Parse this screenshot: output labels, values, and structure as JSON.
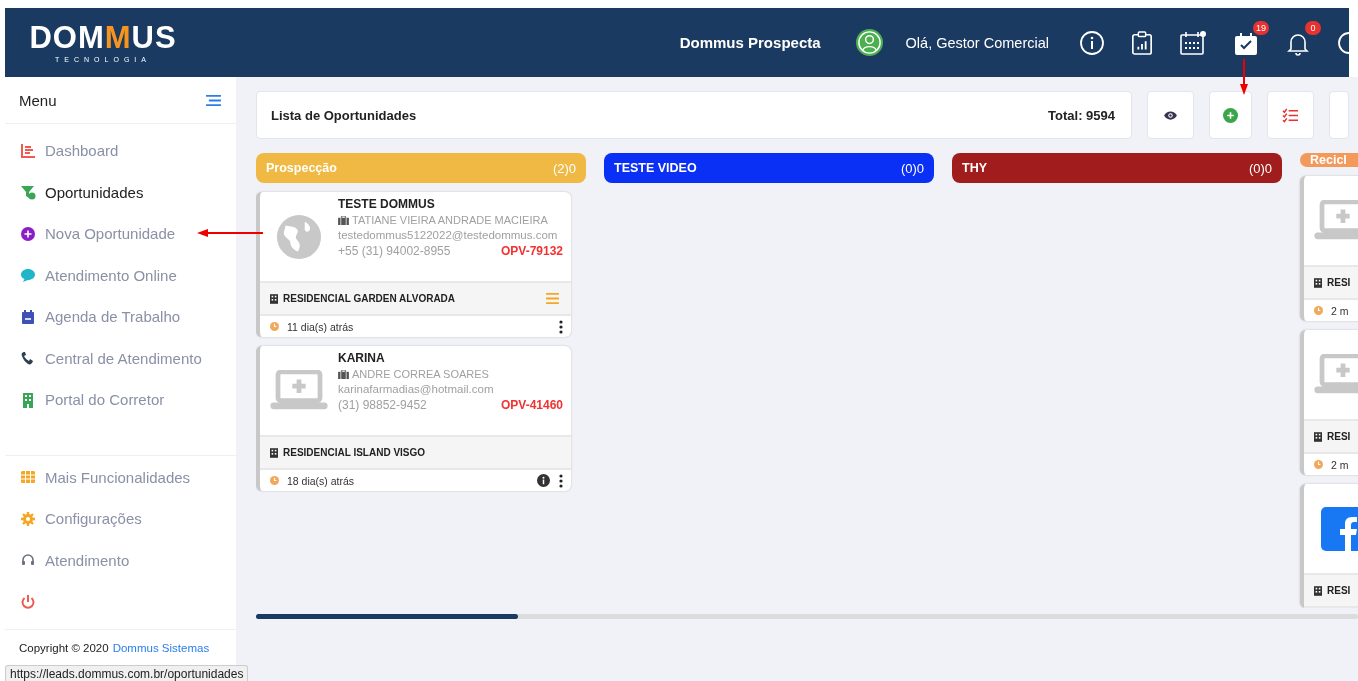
{
  "logo": {
    "lead": "DOM",
    "accent": "M",
    "tail": "US",
    "tagline": "TECNOLOGIA"
  },
  "header": {
    "app_name": "Dommus Prospecta",
    "greeting": "Olá, Gestor Comercial",
    "icons": [
      {
        "kind": "info"
      },
      {
        "kind": "report"
      },
      {
        "kind": "calendar"
      },
      {
        "kind": "tasks",
        "badge": "19"
      },
      {
        "kind": "bell",
        "badge": "0"
      },
      {
        "kind": "partial"
      }
    ]
  },
  "sidebar": {
    "title": "Menu",
    "items": [
      {
        "kind": "chart",
        "label": "Dashboard",
        "color": "#f05a4f",
        "selected": false
      },
      {
        "kind": "funnel",
        "label": "Oportunidades",
        "color": "#3aa655",
        "selected": true
      },
      {
        "kind": "plus",
        "label": "Nova Oportunidade",
        "color": "#8a1fc9",
        "selected": false
      },
      {
        "kind": "chat",
        "label": "Atendimento Online",
        "color": "#1fb6c9",
        "selected": false
      },
      {
        "kind": "agenda",
        "label": "Agenda de Trabalho",
        "color": "#3f51b5",
        "selected": false
      },
      {
        "kind": "phone",
        "label": "Central de Atendimento",
        "color": "#2c3e50",
        "selected": false
      },
      {
        "kind": "building",
        "label": "Portal do Corretor",
        "color": "#3aa655",
        "selected": false
      }
    ],
    "secondary": [
      {
        "kind": "grid",
        "label": "Mais Funcionalidades",
        "color": "#f5a623"
      },
      {
        "kind": "gear",
        "label": "Configurações",
        "color": "#f5a623"
      },
      {
        "kind": "headset",
        "label": "Atendimento",
        "color": "#6b7280"
      },
      {
        "kind": "power",
        "color": "#f05a4f"
      }
    ],
    "copyright": "Copyright © 2020",
    "copyright_link": "Dommus Sistemas"
  },
  "toolbar": {
    "title": "Lista de Oportunidades",
    "total": "Total: 9594",
    "buttons": [
      {
        "kind": "eye"
      },
      {
        "kind": "add"
      },
      {
        "kind": "checklist"
      },
      {
        "kind": "blank"
      }
    ]
  },
  "columns": [
    {
      "title": "Prospecção",
      "count": "(2)0",
      "color": "#efb943",
      "cards": [
        {
          "avatar": {
            "kind": "globe"
          },
          "name": "TESTE DOMMUS",
          "owner": "TATIANE VIEIRA ANDRADE MACIEIRA",
          "email": "testedommus5122022@testedommus.com",
          "phone": "+55 (31) 94002-8955",
          "code": "OPV-79132",
          "development": "RESIDENCIAL GARDEN ALVORADA",
          "dev_action": {
            "kind": "menu"
          },
          "time": "11 dia(s) atrás",
          "time_actions": [
            {
              "kind": "more"
            }
          ]
        },
        {
          "avatar": {
            "kind": "laptop"
          },
          "name": "KARINA",
          "owner": "ANDRE CORREA SOARES",
          "email": "karinafarmadias@hotmail.com",
          "phone": "(31) 98852-9452",
          "code": "OPV-41460",
          "development": "RESIDENCIAL ISLAND VISGO",
          "time": "18 dia(s) atrás",
          "time_actions": [
            {
              "kind": "info"
            },
            {
              "kind": "more"
            }
          ]
        }
      ]
    },
    {
      "title": "TESTE VIDEO",
      "count": "(0)0",
      "color": "#0a2ff5"
    },
    {
      "title": "THY",
      "count": "(0)0",
      "color": "#a11d1d"
    },
    {
      "title": "Recicl",
      "color": "#f39a5b",
      "cards": [
        {
          "avatar": {
            "kind": "laptop"
          },
          "development": "RESI",
          "time": "2 m"
        },
        {
          "avatar": {
            "kind": "laptop"
          },
          "development": "RESI",
          "time": "2 m"
        },
        {
          "avatar": {
            "kind": "facebook"
          },
          "development": "RESI"
        }
      ]
    }
  ],
  "status_url": "https://leads.dommus.com.br/oportunidades"
}
